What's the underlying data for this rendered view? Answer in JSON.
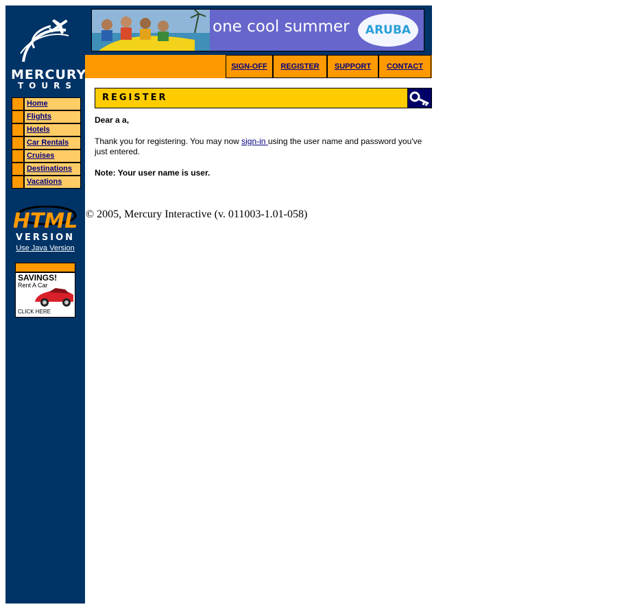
{
  "logo": {
    "line1": "MERCURY",
    "line2": "TOURS"
  },
  "side_menu": [
    "Home",
    "Flights",
    "Hotels",
    "Car Rentals",
    "Cruises",
    "Destinations",
    "Vacations"
  ],
  "html_badge": {
    "line1": "HTML",
    "line2": "VERSION"
  },
  "java_link": "Use Java Version",
  "ad": {
    "title": "SAVINGS!",
    "sub": "Rent A Car",
    "click": "CLICK HERE"
  },
  "banner": {
    "text": "one cool summer",
    "brand": "ARUBA"
  },
  "top_nav": [
    "SIGN-OFF",
    "REGISTER",
    "SUPPORT",
    "CONTACT"
  ],
  "register": {
    "heading": "REGISTER",
    "greeting": "Dear a a,",
    "thanks_before": "Thank you for registering. You may now ",
    "signin_link": "sign-in ",
    "thanks_after": "using the user name and password you've just entered.",
    "note": "Note: Your user name is user."
  },
  "footer": "© 2005, Mercury Interactive (v. 011003-1.01-058)",
  "colors": {
    "navy": "#003366",
    "orange": "#ff9900",
    "light_orange": "#ffcc66",
    "yellow": "#ffcc00",
    "link": "#000080"
  }
}
